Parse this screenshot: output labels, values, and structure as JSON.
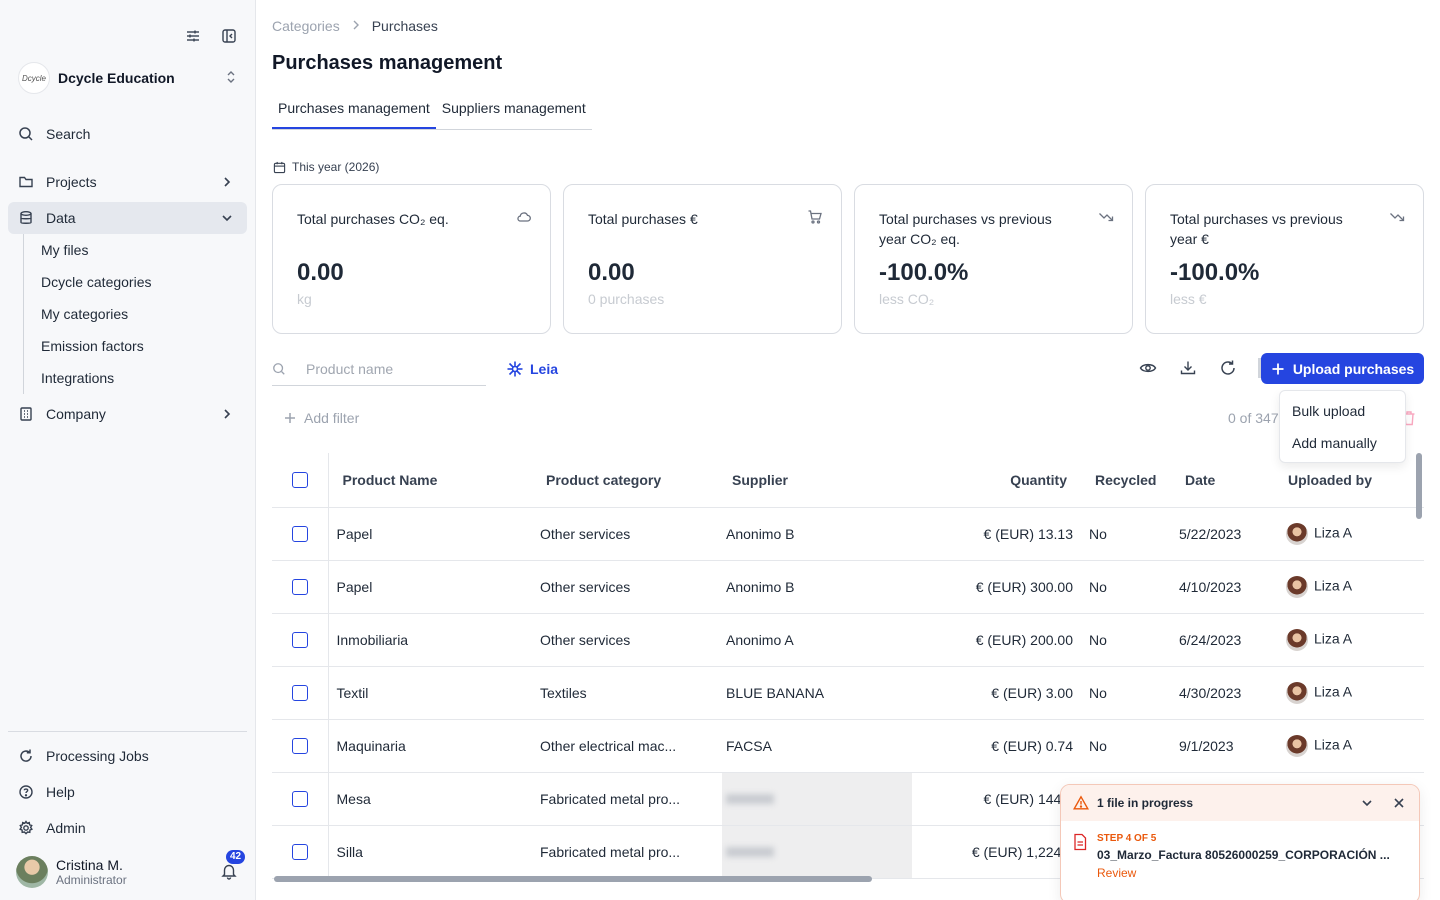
{
  "sidebar": {
    "org_logo_text": "Dcycle",
    "org_name": "Dcycle Education",
    "search_label": "Search",
    "nav": {
      "projects": "Projects",
      "data": "Data",
      "company": "Company"
    },
    "data_subitems": [
      "My files",
      "Dcycle categories",
      "My categories",
      "Emission factors",
      "Integrations"
    ],
    "bottom": {
      "processing_jobs": "Processing Jobs",
      "help": "Help",
      "admin": "Admin"
    },
    "user": {
      "name": "Cristina M.",
      "role": "Administrator",
      "notifications": "42"
    }
  },
  "breadcrumb": {
    "parent": "Categories",
    "current": "Purchases"
  },
  "page_title": "Purchases management",
  "tabs": [
    "Purchases management",
    "Suppliers management"
  ],
  "date_filter": "This year (2026)",
  "cards": [
    {
      "label": "Total purchases CO₂ eq.",
      "value": "0.00",
      "sub": "kg",
      "icon": "cloud-icon"
    },
    {
      "label": "Total purchases €",
      "value": "0.00",
      "sub": "0 purchases",
      "icon": "cart-icon"
    },
    {
      "label": "Total purchases vs previous year CO₂ eq.",
      "value": "-100.0%",
      "sub": "less CO₂",
      "icon": "trend-down-icon"
    },
    {
      "label": "Total purchases vs previous year €",
      "value": "-100.0%",
      "sub": "less €",
      "icon": "trend-down-icon"
    }
  ],
  "toolbar": {
    "search_placeholder": "Product name",
    "leia_label": "Leia",
    "upload_label": "Upload purchases",
    "dropdown": [
      "Bulk upload",
      "Add manually"
    ],
    "add_filter": "Add filter",
    "count": "0 of 347"
  },
  "table": {
    "headers": [
      "Product Name",
      "Product category",
      "Supplier",
      "Quantity",
      "Recycled",
      "Date",
      "Uploaded by"
    ],
    "rows": [
      {
        "name": "Papel",
        "category": "Other services",
        "supplier": "Anonimo B",
        "quantity": "€ (EUR) 13.13",
        "recycled": "No",
        "date": "5/22/2023",
        "uploaded_by": "Liza A"
      },
      {
        "name": "Papel",
        "category": "Other services",
        "supplier": "Anonimo B",
        "quantity": "€ (EUR) 300.00",
        "recycled": "No",
        "date": "4/10/2023",
        "uploaded_by": "Liza A"
      },
      {
        "name": "Inmobiliaria",
        "category": "Other services",
        "supplier": "Anonimo A",
        "quantity": "€ (EUR) 200.00",
        "recycled": "No",
        "date": "6/24/2023",
        "uploaded_by": "Liza A"
      },
      {
        "name": "Textil",
        "category": "Textiles",
        "supplier": "BLUE BANANA",
        "quantity": "€ (EUR) 3.00",
        "recycled": "No",
        "date": "4/30/2023",
        "uploaded_by": "Liza A"
      },
      {
        "name": "Maquinaria",
        "category": "Other electrical mac...",
        "supplier": "FACSA",
        "quantity": "€ (EUR) 0.74",
        "recycled": "No",
        "date": "9/1/2023",
        "uploaded_by": "Liza A"
      },
      {
        "name": "Mesa",
        "category": "Fabricated metal pro...",
        "supplier": "",
        "quantity": "€ (EUR) 144...",
        "recycled": "",
        "date": "",
        "uploaded_by": ""
      },
      {
        "name": "Silla",
        "category": "Fabricated metal pro...",
        "supplier": "",
        "quantity": "€ (EUR) 1,224...",
        "recycled": "",
        "date": "",
        "uploaded_by": ""
      }
    ]
  },
  "toast": {
    "title": "1 file in progress",
    "step": "STEP 4 OF 5",
    "file": "03_Marzo_Factura 80526000259_CORPORACIÓN ...",
    "action": "Review"
  }
}
